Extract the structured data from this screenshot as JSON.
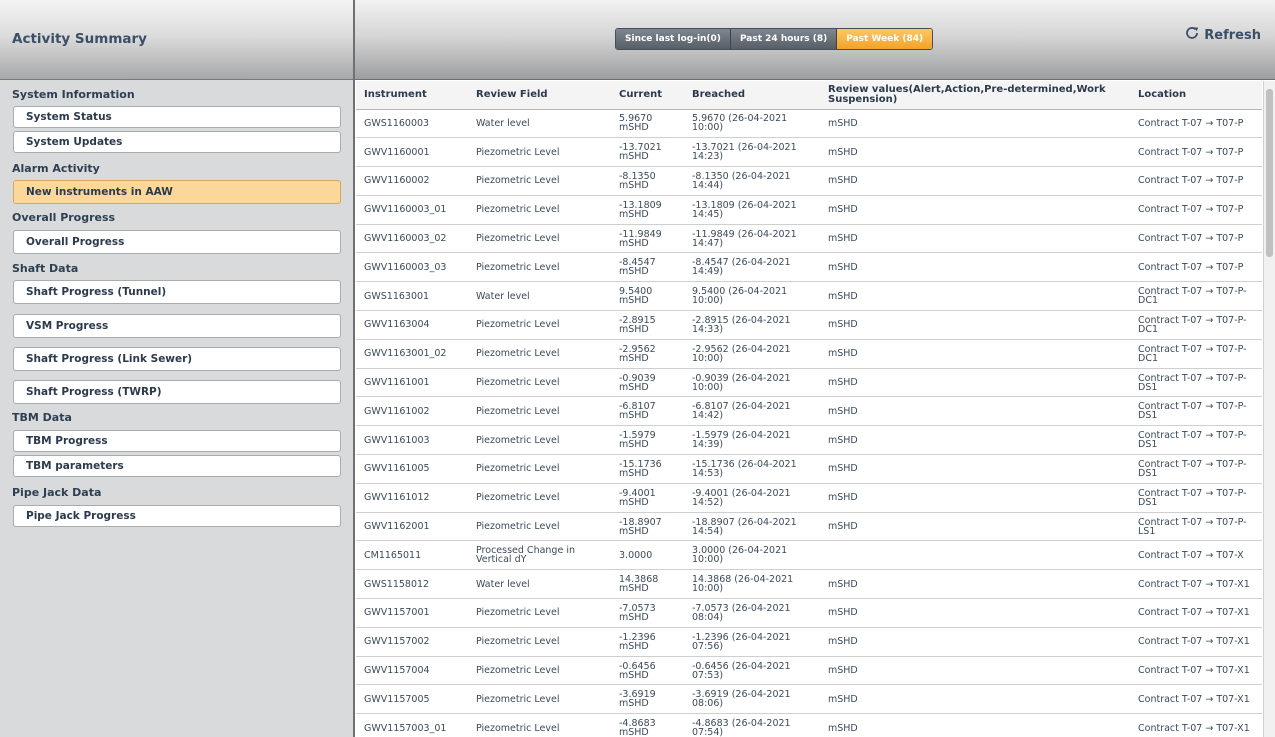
{
  "left": {
    "title": "Activity Summary",
    "sections": [
      {
        "heading": "System Information",
        "items": [
          "System Status",
          "System Updates"
        ]
      },
      {
        "heading": "Alarm Activity",
        "items": [
          "New instruments in AAW"
        ]
      },
      {
        "heading": "Overall Progress",
        "items": [
          "Overall Progress"
        ]
      },
      {
        "heading": "Shaft Data",
        "items": [
          "Shaft Progress (Tunnel)",
          "VSM Progress",
          "Shaft Progress (Link Sewer)",
          "Shaft Progress (TWRP)"
        ]
      },
      {
        "heading": "TBM Data",
        "items": [
          "TBM Progress",
          "TBM parameters"
        ]
      },
      {
        "heading": "Pipe Jack Data",
        "items": [
          "Pipe Jack Progress"
        ]
      }
    ],
    "active_item": "New instruments in AAW"
  },
  "header": {
    "tabs": [
      "Since last log-in(0)",
      "Past 24 hours (8)",
      "Past Week (84)"
    ],
    "active_tab": "Past Week (84)",
    "refresh_label": "Refresh",
    "refresh_icon": "refresh-icon"
  },
  "table": {
    "columns": [
      "Instrument",
      "Review Field",
      "Current",
      "Breached",
      "Review values(Alert,Action,Pre-determined,Work Suspension)",
      "Location"
    ],
    "rows": [
      [
        "GWS1160003",
        "Water level",
        "5.9670 mSHD",
        "5.9670 (26-04-2021 10:00)",
        "mSHD",
        "Contract T-07 → T07-P"
      ],
      [
        "GWV1160001",
        "Piezometric Level",
        "-13.7021 mSHD",
        "-13.7021 (26-04-2021 14:23)",
        "mSHD",
        "Contract T-07 → T07-P"
      ],
      [
        "GWV1160002",
        "Piezometric Level",
        "-8.1350 mSHD",
        "-8.1350 (26-04-2021 14:44)",
        "mSHD",
        "Contract T-07 → T07-P"
      ],
      [
        "GWV1160003_01",
        "Piezometric Level",
        "-13.1809 mSHD",
        "-13.1809 (26-04-2021 14:45)",
        "mSHD",
        "Contract T-07 → T07-P"
      ],
      [
        "GWV1160003_02",
        "Piezometric Level",
        "-11.9849 mSHD",
        "-11.9849 (26-04-2021 14:47)",
        "mSHD",
        "Contract T-07 → T07-P"
      ],
      [
        "GWV1160003_03",
        "Piezometric Level",
        "-8.4547 mSHD",
        "-8.4547 (26-04-2021 14:49)",
        "mSHD",
        "Contract T-07 → T07-P"
      ],
      [
        "GWS1163001",
        "Water level",
        "9.5400 mSHD",
        "9.5400 (26-04-2021 10:00)",
        "mSHD",
        "Contract T-07 → T07-P-DC1"
      ],
      [
        "GWV1163004",
        "Piezometric Level",
        "-2.8915 mSHD",
        "-2.8915 (26-04-2021 14:33)",
        "mSHD",
        "Contract T-07 → T07-P-DC1"
      ],
      [
        "GWV1163001_02",
        "Piezometric Level",
        "-2.9562 mSHD",
        "-2.9562 (26-04-2021 10:00)",
        "mSHD",
        "Contract T-07 → T07-P-DC1"
      ],
      [
        "GWV1161001",
        "Piezometric Level",
        "-0.9039 mSHD",
        "-0.9039 (26-04-2021 10:00)",
        "mSHD",
        "Contract T-07 → T07-P-DS1"
      ],
      [
        "GWV1161002",
        "Piezometric Level",
        "-6.8107 mSHD",
        "-6.8107 (26-04-2021 14:42)",
        "mSHD",
        "Contract T-07 → T07-P-DS1"
      ],
      [
        "GWV1161003",
        "Piezometric Level",
        "-1.5979 mSHD",
        "-1.5979 (26-04-2021 14:39)",
        "mSHD",
        "Contract T-07 → T07-P-DS1"
      ],
      [
        "GWV1161005",
        "Piezometric Level",
        "-15.1736 mSHD",
        "-15.1736 (26-04-2021 14:53)",
        "mSHD",
        "Contract T-07 → T07-P-DS1"
      ],
      [
        "GWV1161012",
        "Piezometric Level",
        "-9.4001 mSHD",
        "-9.4001 (26-04-2021 14:52)",
        "mSHD",
        "Contract T-07 → T07-P-DS1"
      ],
      [
        "GWV1162001",
        "Piezometric Level",
        "-18.8907 mSHD",
        "-18.8907 (26-04-2021 14:54)",
        "mSHD",
        "Contract T-07 → T07-P-LS1"
      ],
      [
        "CM1165011",
        "Processed Change in Vertical dY",
        "3.0000",
        "3.0000 (26-04-2021 10:00)",
        "",
        "Contract T-07 → T07-X"
      ],
      [
        "GWS1158012",
        "Water level",
        "14.3868 mSHD",
        "14.3868 (26-04-2021 10:00)",
        "mSHD",
        "Contract T-07 → T07-X1"
      ],
      [
        "GWV1157001",
        "Piezometric Level",
        "-7.0573 mSHD",
        "-7.0573 (26-04-2021 08:04)",
        "mSHD",
        "Contract T-07 → T07-X1"
      ],
      [
        "GWV1157002",
        "Piezometric Level",
        "-1.2396 mSHD",
        "-1.2396 (26-04-2021 07:56)",
        "mSHD",
        "Contract T-07 → T07-X1"
      ],
      [
        "GWV1157004",
        "Piezometric Level",
        "-0.6456 mSHD",
        "-0.6456 (26-04-2021 07:53)",
        "mSHD",
        "Contract T-07 → T07-X1"
      ],
      [
        "GWV1157005",
        "Piezometric Level",
        "-3.6919 mSHD",
        "-3.6919 (26-04-2021 08:06)",
        "mSHD",
        "Contract T-07 → T07-X1"
      ],
      [
        "GWV1157003_01",
        "Piezometric Level",
        "-4.8683 mSHD",
        "-4.8683 (26-04-2021 07:54)",
        "mSHD",
        "Contract T-07 → T07-X1"
      ]
    ]
  },
  "colors": {
    "active_orange": "#f3a227",
    "active_nav": "#fbd89a",
    "title_blue": "#3a4f66"
  }
}
